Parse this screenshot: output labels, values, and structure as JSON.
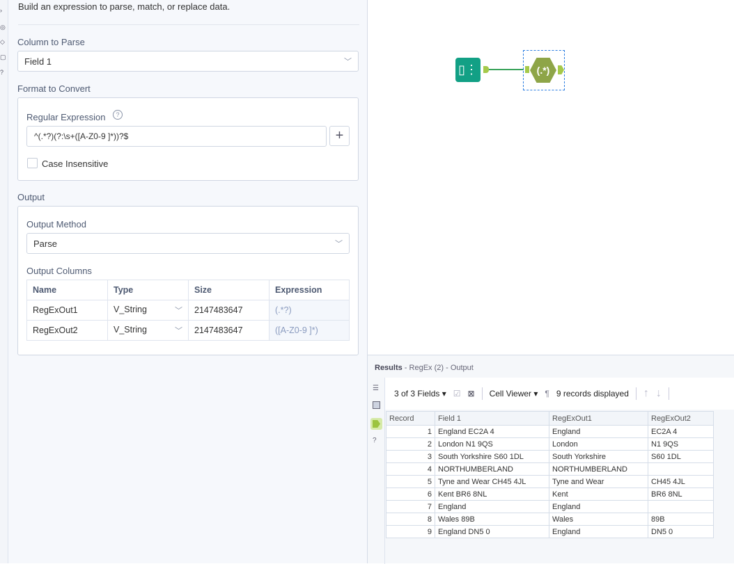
{
  "panel": {
    "description": "Build an expression to parse, match, or replace data.",
    "column_label": "Column to Parse",
    "column_value": "Field 1",
    "format_label": "Format to Convert",
    "regex_label": "Regular Expression",
    "regex_value": "^(.*?)(?:\\s+([A-Z0-9 ]*))?$",
    "case_label": "Case Insensitive",
    "output_label": "Output",
    "method_label": "Output Method",
    "method_value": "Parse",
    "columns_label": "Output Columns",
    "columns_headers": [
      "Name",
      "Type",
      "Size",
      "Expression"
    ],
    "columns_rows": [
      [
        "RegExOut1",
        "V_String",
        "2147483647",
        "(.*?)"
      ],
      [
        "RegExOut2",
        "V_String",
        "2147483647",
        "([A-Z0-9 ]*)"
      ]
    ]
  },
  "canvas": {
    "tool_label": "(.*)"
  },
  "results": {
    "title": "Results",
    "subtitle": " - RegEx (2) - Output",
    "fields": "3 of 3 Fields",
    "viewer": "Cell Viewer",
    "records": "9 records displayed",
    "headers": [
      "Record",
      "Field 1",
      "RegExOut1",
      "RegExOut2"
    ],
    "rows": [
      [
        "1",
        "England EC2A 4",
        "England",
        "EC2A 4"
      ],
      [
        "2",
        "London N1 9QS",
        "London",
        "N1 9QS"
      ],
      [
        "3",
        "South Yorkshire  S60 1DL",
        "South Yorkshire",
        "S60 1DL"
      ],
      [
        "4",
        "NORTHUMBERLAND",
        "NORTHUMBERLAND",
        ""
      ],
      [
        "5",
        "Tyne and Wear CH45 4JL",
        "Tyne and Wear",
        "CH45 4JL"
      ],
      [
        "6",
        "Kent BR6 8NL",
        "Kent",
        "BR6 8NL"
      ],
      [
        "7",
        "England",
        "England",
        ""
      ],
      [
        "8",
        "Wales 89B",
        "Wales",
        "89B"
      ],
      [
        "9",
        "England DN5 0",
        "England",
        "DN5 0"
      ]
    ]
  }
}
